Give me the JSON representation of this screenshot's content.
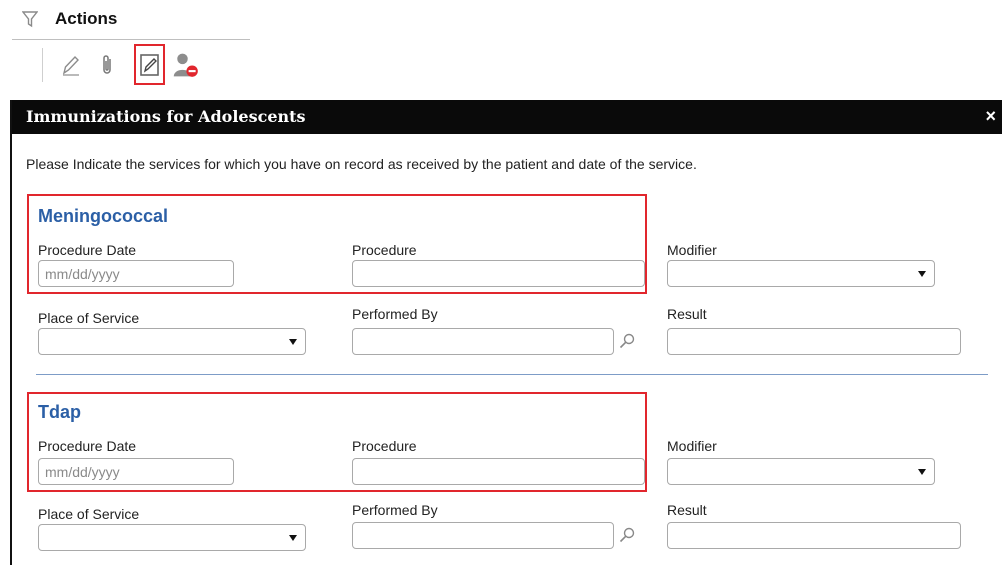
{
  "actions": {
    "title": "Actions"
  },
  "dialog": {
    "title": "Immunizations for Adolescents",
    "close_label": "×",
    "instruction": "Please Indicate the services for which you have on record as received by the patient and date of the service."
  },
  "sections": [
    {
      "title": "Meningococcal",
      "procedure_date_label": "Procedure Date",
      "procedure_date_placeholder": "mm/dd/yyyy",
      "procedure_label": "Procedure",
      "modifier_label": "Modifier",
      "place_of_service_label": "Place of Service",
      "performed_by_label": "Performed By",
      "result_label": "Result"
    },
    {
      "title": "Tdap",
      "procedure_date_label": "Procedure Date",
      "procedure_date_placeholder": "mm/dd/yyyy",
      "procedure_label": "Procedure",
      "modifier_label": "Modifier",
      "place_of_service_label": "Place of Service",
      "performed_by_label": "Performed By",
      "result_label": "Result"
    }
  ],
  "colors": {
    "highlight": "#e1262d",
    "section_title": "#2b5fa6",
    "titlebar": "#0a0a0a"
  },
  "icons": [
    "filter-icon",
    "pencil-icon",
    "paperclip-icon",
    "edit-form-icon",
    "user-remove-icon",
    "close-icon",
    "search-icon",
    "dropdown-arrow-icon"
  ]
}
